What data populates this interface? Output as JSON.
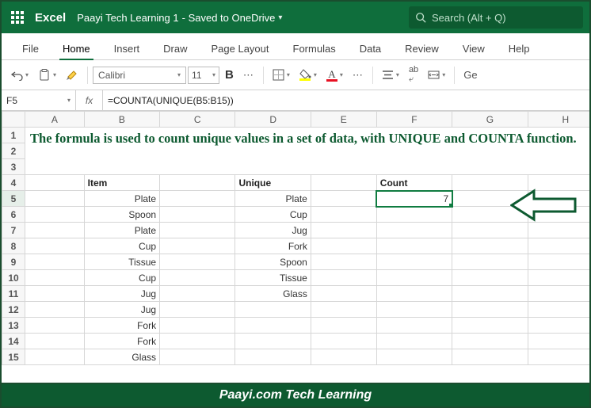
{
  "title": {
    "app": "Excel",
    "doc": "Paayi Tech Learning 1",
    "saved": " - Saved to OneDrive",
    "search_placeholder": "Search (Alt + Q)"
  },
  "tabs": [
    "File",
    "Home",
    "Insert",
    "Draw",
    "Page Layout",
    "Formulas",
    "Data",
    "Review",
    "View",
    "Help"
  ],
  "active_tab": 1,
  "ribbon": {
    "font_name": "Calibri",
    "font_size": "11",
    "bold": "B",
    "general": "Ge"
  },
  "namebox": "F5",
  "fx": "fx",
  "formula": "=COUNTA(UNIQUE(B5:B15))",
  "columns": [
    "A",
    "B",
    "C",
    "D",
    "E",
    "F",
    "G",
    "H"
  ],
  "row_labels": [
    "1",
    "2",
    "3",
    "4",
    "5",
    "6",
    "7",
    "8",
    "9",
    "10",
    "11",
    "12",
    "13",
    "14",
    "15"
  ],
  "headline": "The formula is used to count unique values in a set of data, with UNIQUE and COUNTA function.",
  "headers": {
    "item": "Item",
    "unique": "Unique",
    "count": "Count"
  },
  "items": [
    "Plate",
    "Spoon",
    "Plate",
    "Cup",
    "Tissue",
    "Cup",
    "Jug",
    "Jug",
    "Fork",
    "Fork",
    "Glass"
  ],
  "unique": [
    "Plate",
    "Cup",
    "Jug",
    "Fork",
    "Spoon",
    "Tissue",
    "Glass"
  ],
  "count": "7",
  "footer": "Paayi.com Tech Learning"
}
